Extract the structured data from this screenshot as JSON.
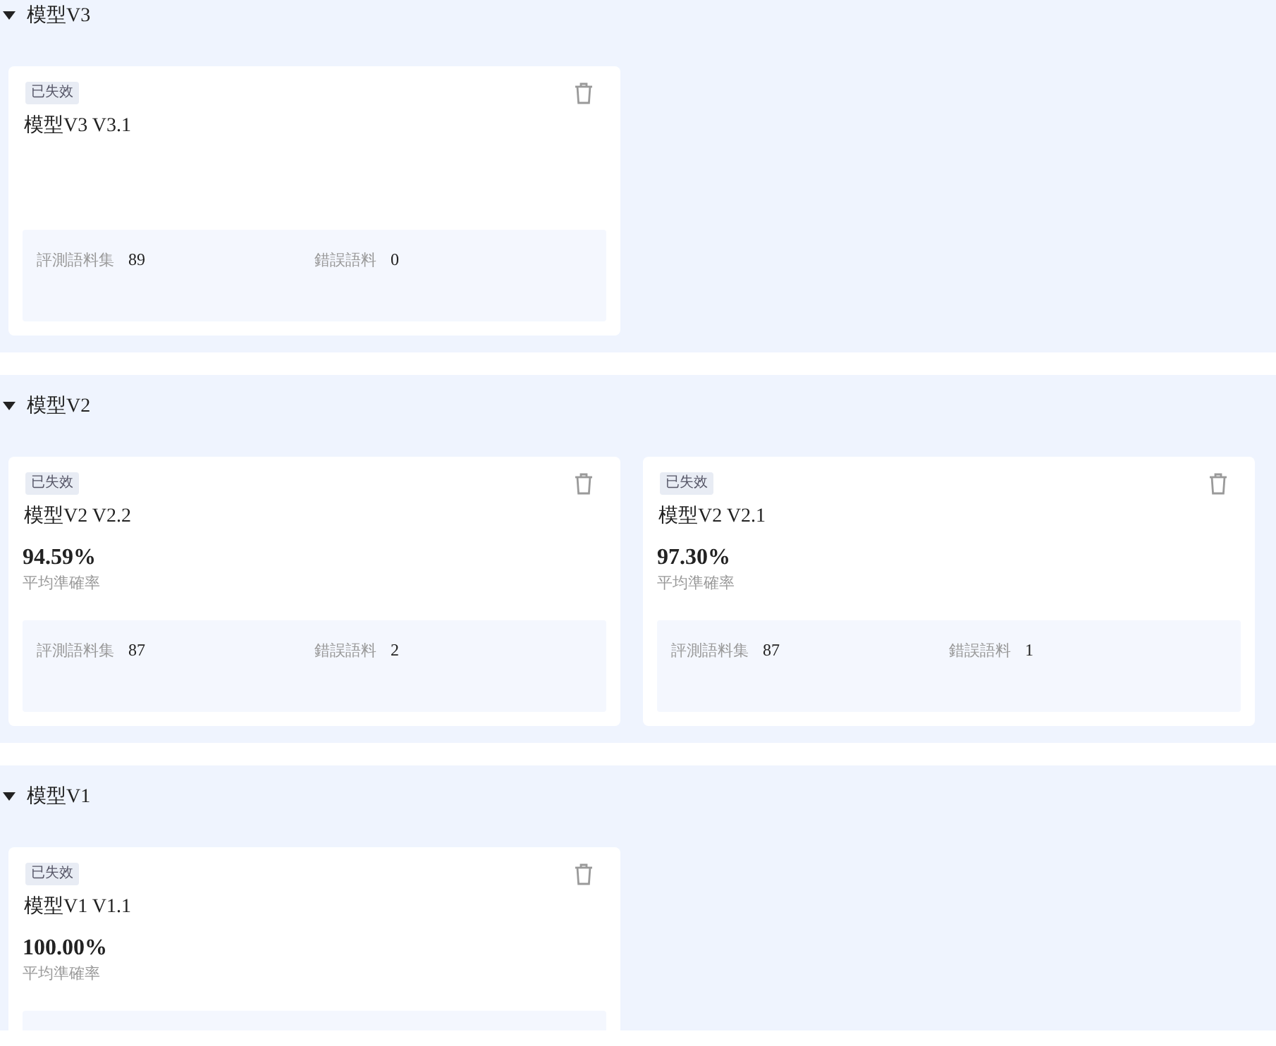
{
  "groups": [
    {
      "title": "模型V3",
      "expanded": true,
      "cards": [
        {
          "status": "已失效",
          "name": "模型V3 V3.1",
          "stats": [
            {
              "label": "評測語料集",
              "value": "89"
            },
            {
              "label": "錯誤語料",
              "value": "0"
            }
          ]
        }
      ]
    },
    {
      "title": "模型V2",
      "expanded": true,
      "cards": [
        {
          "status": "已失效",
          "name": "模型V2 V2.2",
          "accuracy": "94.59%",
          "accuracy_label": "平均準確率",
          "stats": [
            {
              "label": "評測語料集",
              "value": "87"
            },
            {
              "label": "錯誤語料",
              "value": "2"
            }
          ]
        },
        {
          "status": "已失效",
          "name": "模型V2 V2.1",
          "accuracy": "97.30%",
          "accuracy_label": "平均準確率",
          "stats": [
            {
              "label": "評測語料集",
              "value": "87"
            },
            {
              "label": "錯誤語料",
              "value": "1"
            }
          ]
        }
      ]
    },
    {
      "title": "模型V1",
      "expanded": true,
      "cards": [
        {
          "status": "已失效",
          "name": "模型V1 V1.1",
          "accuracy": "100.00%",
          "accuracy_label": "平均準確率"
        }
      ]
    }
  ]
}
